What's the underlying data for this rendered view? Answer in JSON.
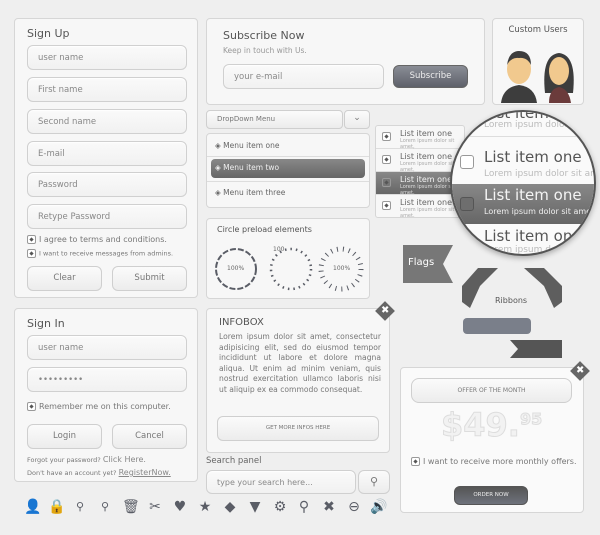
{
  "signup": {
    "title": "Sign Up",
    "fields": [
      "user name",
      "First name",
      "Second name",
      "E-mail",
      "Password",
      "Retype Password"
    ],
    "agree": "I agree to terms and conditions.",
    "receive": "I want to receive messages from admins.",
    "clear": "Clear",
    "submit": "Submit"
  },
  "signin": {
    "title": "Sign In",
    "username": "user name",
    "password": "•••••••••",
    "remember": "Remember me on this computer.",
    "login": "Login",
    "cancel": "Cancel",
    "forgot": "Forgot your password?",
    "click_here": "Click Here.",
    "no_account": "Don't have an account yet?",
    "register": "RegisterNow."
  },
  "subscribe": {
    "title": "Subscribe Now",
    "subtitle": "Keep in touch with Us.",
    "placeholder": "your e-mail",
    "button": "Subscribe"
  },
  "users": {
    "title": "Custom Users"
  },
  "dropdown": {
    "label": "DropDown Menu",
    "items": [
      "Menu item  one",
      "Menu item  two",
      "Menu item three"
    ],
    "selected": 1
  },
  "preload": {
    "title": "Circle preload elements",
    "values": [
      "100%",
      "100",
      "100%"
    ]
  },
  "list": {
    "items": [
      {
        "title": "List item one",
        "sub": "Lorem ipsum dolor sit amet,"
      },
      {
        "title": "List item one",
        "sub": "Lorem ipsum dolor sit amet,"
      },
      {
        "title": "List item one",
        "sub": "Lorem ipsum dolor sit amet,"
      },
      {
        "title": "List item one",
        "sub": "Lorem ipsum dolor sit amet,"
      }
    ]
  },
  "flags": {
    "label": "Flags"
  },
  "ribbons": {
    "label": "Ribbons"
  },
  "infobox": {
    "title": "INFOBOX",
    "text": "Lorem ipsum dolor sit amet, consectetur adipisicing elit, sed do eiusmod tempor incididunt ut labore et dolore magna aliqua. Ut enim ad minim veniam, quis nostrud exercitation ullamco laboris nisi ut aliquip ex ea commodo consequat.",
    "button": "GET MORE INFOS HERE"
  },
  "search": {
    "label": "Search panel",
    "placeholder": "type your search here..."
  },
  "offer": {
    "title": "OFFER OF THE MONTH",
    "price": "$49.",
    "cents": "95",
    "checkbox": "I want to receive more monthly offers.",
    "button": "ORDER NOW"
  },
  "icons": [
    "user-icon",
    "lock-icon",
    "zoom-in-icon",
    "zoom-out-icon",
    "trash-icon",
    "scissors-icon",
    "heart-icon",
    "star-icon",
    "speech-bubble-icon",
    "pin-icon",
    "gear-icon",
    "map-marker-icon",
    "close-circle-icon",
    "minus-circle-icon",
    "speaker-icon"
  ],
  "colors": {
    "dark": "#5a5d66",
    "highlight": "#707070"
  }
}
